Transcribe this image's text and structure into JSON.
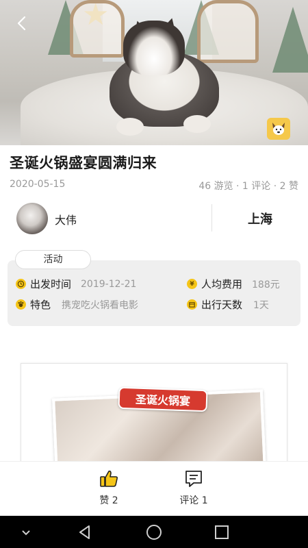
{
  "post": {
    "title": "圣诞火锅盛宴圆满归来",
    "date": "2020-05-15",
    "stats": "46 游览 · 1 评论 · 2 赞"
  },
  "author": {
    "name": "大伟",
    "city": "上海"
  },
  "activity": {
    "tag": "活动",
    "items": [
      {
        "icon": "clock-icon",
        "label": "出发时间",
        "value": "2019-12-21"
      },
      {
        "icon": "yen-icon",
        "label": "人均费用",
        "value": "188元"
      },
      {
        "icon": "feature-icon",
        "label": "特色",
        "value": "携宠吃火锅看电影"
      },
      {
        "icon": "calendar-icon",
        "label": "出行天数",
        "value": "1天"
      }
    ]
  },
  "photo": {
    "banner": "圣诞火锅宴"
  },
  "actions": {
    "like": "赞 2",
    "comment": "评论 1"
  },
  "colors": {
    "accent": "#f5c518",
    "banner_red": "#d63a2f",
    "muted_text": "#999999"
  }
}
